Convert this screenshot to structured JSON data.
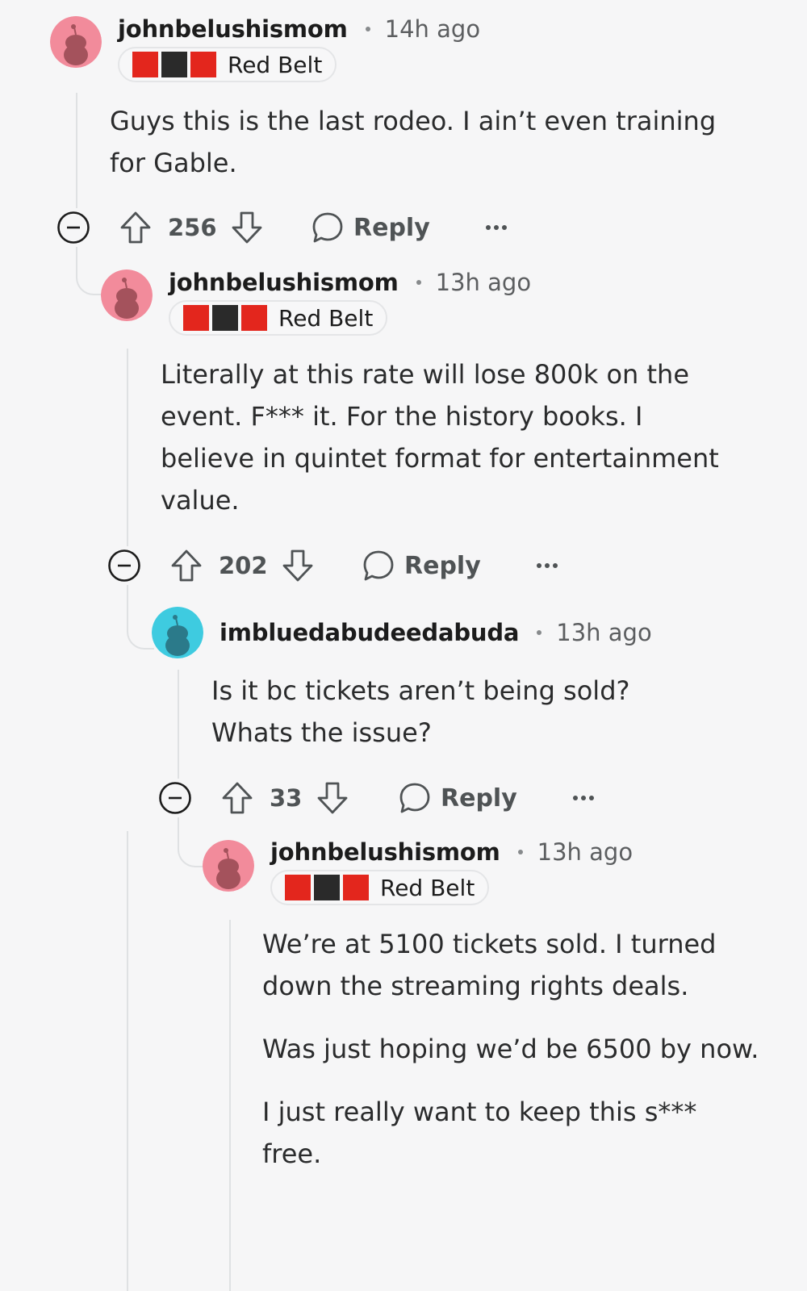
{
  "comments": [
    {
      "username": "johnbelushismom",
      "time": "14h ago",
      "flair": "Red Belt",
      "avatar_color": "#f28b9b",
      "paragraphs": [
        "Guys this is the last rodeo. I ain’t even training for Gable."
      ],
      "score": "256",
      "reply_label": "Reply",
      "more_label": "···"
    },
    {
      "username": "johnbelushismom",
      "time": "13h ago",
      "flair": "Red Belt",
      "avatar_color": "#f28b9b",
      "paragraphs": [
        "Literally at this rate will lose 800k on the event. F*** it. For the history books. I believe in quintet format for entertainment value."
      ],
      "score": "202",
      "reply_label": "Reply",
      "more_label": "···"
    },
    {
      "username": "imbluedabudeedabuda",
      "time": "13h ago",
      "avatar_color": "#3ecbe0",
      "paragraphs": [
        "Is it bc tickets aren’t being sold? Whats the issue?"
      ],
      "score": "33",
      "reply_label": "Reply",
      "more_label": "···"
    },
    {
      "username": "johnbelushismom",
      "time": "13h ago",
      "flair": "Red Belt",
      "avatar_color": "#f28b9b",
      "paragraphs": [
        "We’re at 5100 tickets sold. I turned down the streaming rights deals.",
        "Was just hoping we’d be 6500 by now.",
        "I just really want to keep this s*** free."
      ]
    }
  ],
  "icons": {
    "collapse": "collapse-minus-icon",
    "upvote": "upvote-arrow-icon",
    "downvote": "downvote-arrow-icon",
    "reply": "speech-bubble-icon",
    "more": "more-dots-icon",
    "avatar": "snoo-avatar-icon"
  },
  "colors": {
    "belt_red": "#e3261d",
    "belt_black": "#2a2a2a",
    "thread_line": "#dfe1e3",
    "action_gray": "#4f5355"
  }
}
